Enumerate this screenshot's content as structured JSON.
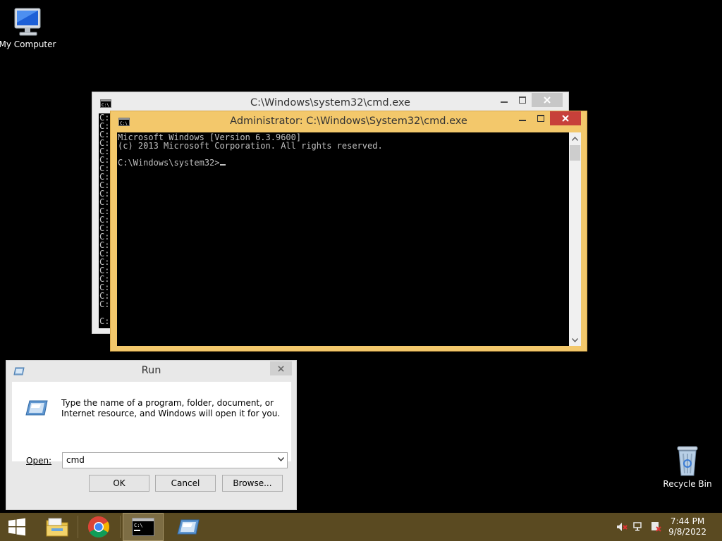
{
  "desktop": {
    "icons": [
      {
        "label": "My Computer",
        "icon": "computer-icon"
      },
      {
        "label": "Recycle Bin",
        "icon": "recycle-bin-icon"
      }
    ]
  },
  "back_console": {
    "title": "C:\\Windows\\system32\\cmd.exe",
    "line_prefix": "C:",
    "visible_prefix_count": 23
  },
  "front_console": {
    "title": "Administrator: C:\\Windows\\System32\\cmd.exe",
    "lines": [
      "Microsoft Windows [Version 6.3.9600]",
      "(c) 2013 Microsoft Corporation. All rights reserved.",
      "",
      "C:\\Windows\\system32>"
    ]
  },
  "run_dialog": {
    "title": "Run",
    "description": "Type the name of a program, folder, document, or Internet resource, and Windows will open it for you.",
    "open_label": "Open:",
    "open_value": "cmd",
    "ok_label": "OK",
    "cancel_label": "Cancel",
    "browse_label": "Browse..."
  },
  "taskbar": {
    "items": [
      {
        "icon": "start-icon"
      },
      {
        "icon": "file-explorer-icon"
      },
      {
        "icon": "chrome-icon"
      },
      {
        "icon": "command-prompt-icon",
        "active": true
      },
      {
        "icon": "run-icon"
      }
    ],
    "clock": {
      "time": "7:44 PM",
      "date": "9/8/2022"
    }
  },
  "colors": {
    "front_frame": "#f3c86b",
    "close_red": "#c7403a",
    "taskbar": "#5a4a21",
    "console_bg": "#000000",
    "console_text": "#c0c0c0"
  }
}
